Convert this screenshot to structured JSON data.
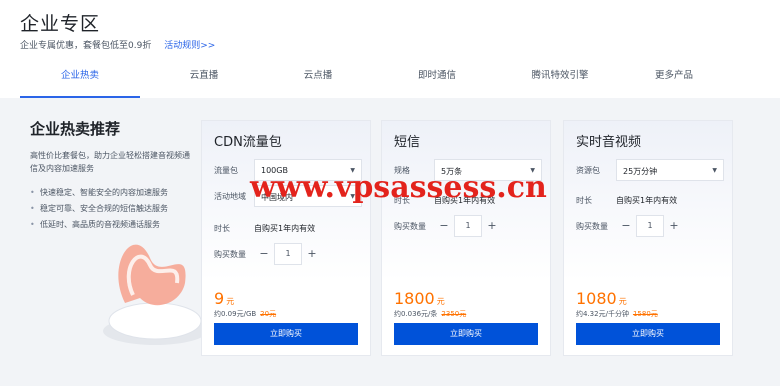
{
  "header": {
    "title": "企业专区",
    "subtitle": "企业专属优惠，套餐包低至0.9折",
    "link": "活动规则>>"
  },
  "tabs": [
    {
      "label": "企业热卖",
      "active": true
    },
    {
      "label": "云直播",
      "active": false
    },
    {
      "label": "云点播",
      "active": false
    },
    {
      "label": "即时通信",
      "active": false
    },
    {
      "label": "腾讯特效引擎",
      "active": false
    },
    {
      "label": "更多产品",
      "active": false
    }
  ],
  "promo": {
    "title": "企业热卖推荐",
    "desc": "高性价比套餐包，助力企业轻松搭建音视频通信及内容加速服务",
    "bullets": [
      "快速稳定、智能安全的内容加速服务",
      "稳定可靠、安全合规的短信触达服务",
      "低延时、高品质的音视频通话服务"
    ]
  },
  "cards": [
    {
      "title": "CDN流量包",
      "rows": [
        {
          "label": "流量包",
          "type": "select",
          "value": "100GB"
        },
        {
          "label": "活动地域",
          "type": "select",
          "value": "中国境内"
        },
        {
          "label": "时长",
          "type": "text",
          "value": "自购买1年内有效"
        },
        {
          "label": "购买数量",
          "type": "stepper",
          "value": "1"
        }
      ],
      "price": "9",
      "price_unit": "元",
      "unit_price": "约0.09元/GB",
      "original": "20元",
      "buy": "立即购买"
    },
    {
      "title": "短信",
      "rows": [
        {
          "label": "规格",
          "type": "select",
          "value": "5万条"
        },
        {
          "label": "时长",
          "type": "text",
          "value": "自购买1年内有效"
        },
        {
          "label": "购买数量",
          "type": "stepper",
          "value": "1"
        }
      ],
      "price": "1800",
      "price_unit": "元",
      "unit_price": "约0.036元/条",
      "original": "2350元",
      "buy": "立即购买"
    },
    {
      "title": "实时音视频",
      "rows": [
        {
          "label": "资源包",
          "type": "select",
          "value": "25万分钟"
        },
        {
          "label": "时长",
          "type": "text",
          "value": "自购买1年内有效"
        },
        {
          "label": "购买数量",
          "type": "stepper",
          "value": "1"
        }
      ],
      "price": "1080",
      "price_unit": "元",
      "unit_price": "约4.32元/千分钟",
      "original": "1580元",
      "buy": "立即购买"
    }
  ],
  "stepper": {
    "minus": "−",
    "plus": "+"
  },
  "watermark": "www.vpsassess.cn",
  "colors": {
    "accent": "#0052d9",
    "price": "#ff7200",
    "watermark": "#e3231c"
  }
}
